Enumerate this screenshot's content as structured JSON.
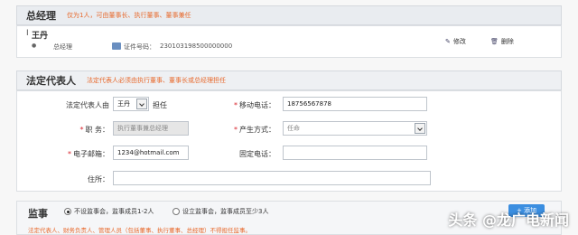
{
  "manager_section": {
    "title": "总经理",
    "note": "仅为1人，可由董事长、执行董事、董事兼任",
    "person_name": "王丹",
    "person_role": "总经理",
    "id_label": "证件号码：",
    "id_value": "230103198500000000",
    "edit_label": "修改",
    "delete_label": "删除"
  },
  "legal_rep_section": {
    "title": "法定代表人",
    "note": "法定代表人必须由执行董事、董事长或总经理担任",
    "rep_by_label": "法定代表人由",
    "rep_by_value": "王丹",
    "rep_by_suffix": "担任",
    "position_label": "职  务：",
    "position_value": "执行董事兼总经理",
    "email_label": "电子邮箱：",
    "email_value": "1234@hotmail.com",
    "address_label": "住所：",
    "address_value": "",
    "mobile_label": "移动电话：",
    "mobile_value": "18756567878",
    "method_label": "产生方式：",
    "method_value": "任命",
    "landline_label": "固定电话：",
    "landline_value": ""
  },
  "supervisor_section": {
    "title": "监事",
    "option1": "不设监事会，监事成员1-2人",
    "option2": "设立监事会，监事成员至少3人",
    "selected": 1,
    "add_button": "添加",
    "note": "法定代表人、财务负责人、管理人员（包括董事、执行董事、总经理）不得担任监事。"
  },
  "watermark": "头条 @龙广电新闻",
  "colors": {
    "accent": "#e8692c",
    "header_bg": "#e9ecf0",
    "button": "#3b8ee0"
  }
}
